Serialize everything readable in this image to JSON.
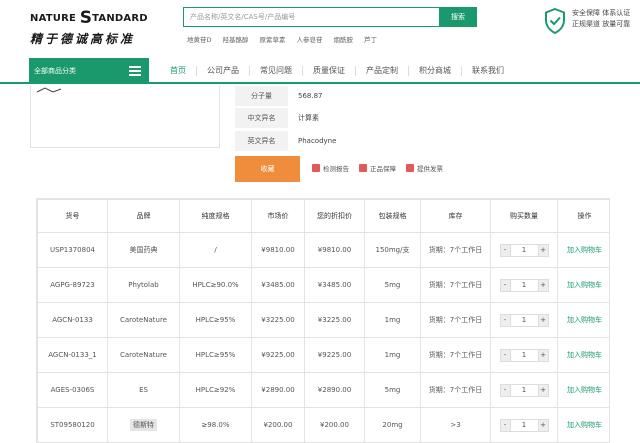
{
  "header": {
    "logo_top": "NATURE",
    "logo_s": "S",
    "logo_rest": "TANDARD",
    "logo_slogan": "精于德诚高标准",
    "search_placeholder": "产品名称/英文名/CAS号/产品编号",
    "search_button": "搜索",
    "hot_words": [
      "地黄苷D",
      "羟基酪醇",
      "原紫草素",
      "人参皂苷",
      "烟酰胺",
      "芦丁"
    ],
    "guarantee_line1": "安全保障 体系认证",
    "guarantee_line2": "正规渠道 放量可靠"
  },
  "nav": {
    "category_label": "全部商品分类",
    "items": [
      "首页",
      "公司产品",
      "常见问题",
      "质量保证",
      "产品定制",
      "积分商城",
      "联系我们"
    ]
  },
  "info": {
    "rows": [
      {
        "label": "分子量",
        "value": "568.87"
      },
      {
        "label": "中文异名",
        "value": "计算素"
      },
      {
        "label": "英文异名",
        "value": "Phacodyne"
      }
    ],
    "favorite_button": "收藏",
    "actions": [
      "检测报告",
      "正品保障",
      "提供发票"
    ]
  },
  "table": {
    "headers": [
      "货号",
      "品牌",
      "纯度规格",
      "市场价",
      "您的折扣价",
      "包装规格",
      "库存",
      "购买数量",
      "操作"
    ],
    "rows": [
      {
        "sku": "USP1370804",
        "brand": "美国药典",
        "purity": "/",
        "market": "¥9810.00",
        "discount": "¥9810.00",
        "pack": "150mg/支",
        "stock": "货期：7个工作日",
        "qty": "1",
        "op": "加入购物车"
      },
      {
        "sku": "AGPG-89723",
        "brand": "Phytolab",
        "purity": "HPLC≥90.0%",
        "market": "¥3485.00",
        "discount": "¥3485.00",
        "pack": "5mg",
        "stock": "货期：7个工作日",
        "qty": "1",
        "op": "加入购物车"
      },
      {
        "sku": "AGCN-0133",
        "brand": "CaroteNature",
        "purity": "HPLC≥95%",
        "market": "¥3225.00",
        "discount": "¥3225.00",
        "pack": "1mg",
        "stock": "货期：7个工作日",
        "qty": "1",
        "op": "加入购物车"
      },
      {
        "sku": "AGCN-0133_1",
        "brand": "CaroteNature",
        "purity": "HPLC≥95%",
        "market": "¥9225.00",
        "discount": "¥9225.00",
        "pack": "1mg",
        "stock": "货期：7个工作日",
        "qty": "1",
        "op": "加入购物车"
      },
      {
        "sku": "AGES-0306S",
        "brand": "ES",
        "purity": "HPLC≥92%",
        "market": "¥2890.00",
        "discount": "¥2890.00",
        "pack": "5mg",
        "stock": "货期：7个工作日",
        "qty": "1",
        "op": "加入购物车"
      },
      {
        "sku": "ST09580120",
        "brand": "德斯特",
        "purity": "≥98.0%",
        "market": "¥200.00",
        "discount": "¥200.00",
        "pack": "20mg",
        "stock": ">3",
        "qty": "1",
        "op": "加入购物车"
      }
    ]
  },
  "colors": {
    "accent": "#1a9a6c",
    "orange": "#f08d3c"
  }
}
